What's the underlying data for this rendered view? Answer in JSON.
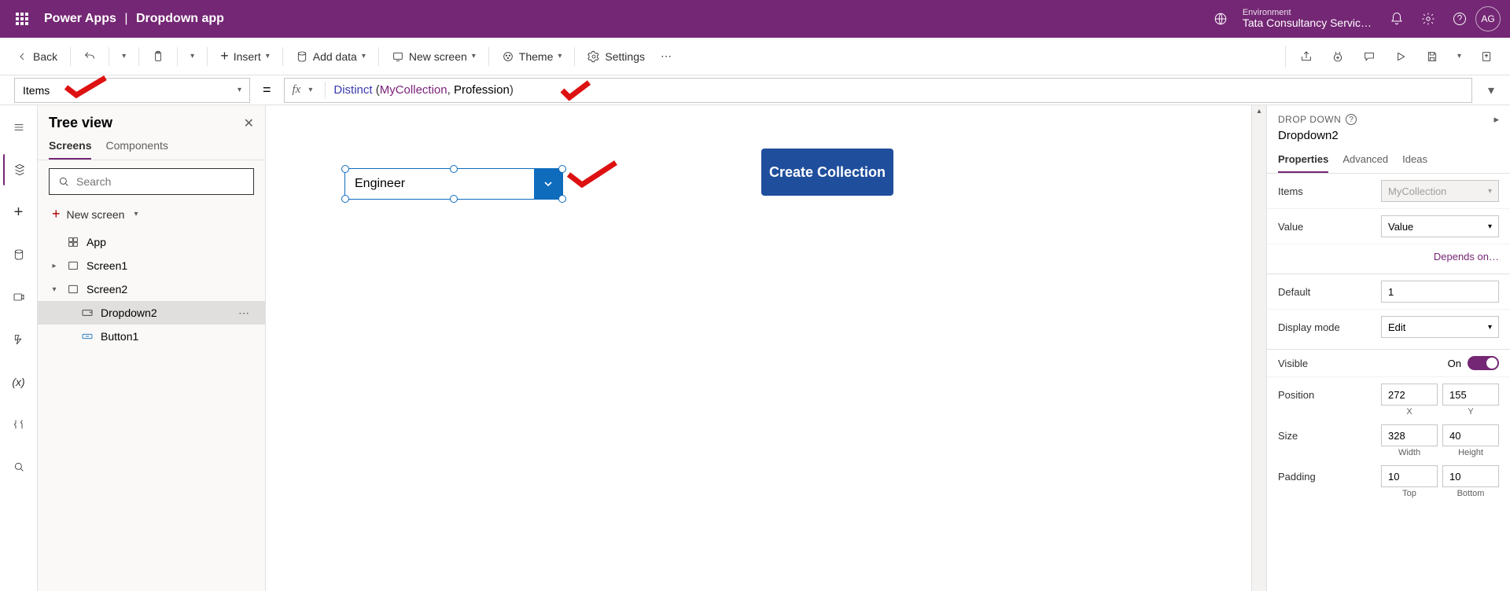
{
  "header": {
    "product": "Power Apps",
    "separator": "|",
    "app_name": "Dropdown app",
    "env_label": "Environment",
    "env_name": "Tata Consultancy Servic…",
    "avatar": "AG"
  },
  "cmdbar": {
    "back": "Back",
    "insert": "Insert",
    "add_data": "Add data",
    "new_screen": "New screen",
    "theme": "Theme",
    "settings": "Settings"
  },
  "formula": {
    "property": "Items",
    "fx_label": "fx",
    "func": "Distinct",
    "paren_open": "(",
    "collection": "MyCollection",
    "comma": ", ",
    "field": "Profession",
    "paren_close": ")"
  },
  "tree": {
    "title": "Tree view",
    "tabs": {
      "screens": "Screens",
      "components": "Components"
    },
    "search_placeholder": "Search",
    "new_screen": "New screen",
    "app": "App",
    "screen1": "Screen1",
    "screen2": "Screen2",
    "dropdown2": "Dropdown2",
    "button1": "Button1"
  },
  "canvas": {
    "dropdown_value": "Engineer",
    "create_button": "Create Collection"
  },
  "props": {
    "type_label": "DROP DOWN",
    "control_name": "Dropdown2",
    "tabs": {
      "properties": "Properties",
      "advanced": "Advanced",
      "ideas": "Ideas"
    },
    "items_label": "Items",
    "items_value": "MyCollection",
    "value_label": "Value",
    "value_value": "Value",
    "depends": "Depends on…",
    "default_label": "Default",
    "default_value": "1",
    "display_mode_label": "Display mode",
    "display_mode_value": "Edit",
    "visible_label": "Visible",
    "visible_on": "On",
    "position_label": "Position",
    "pos_x": "272",
    "pos_y": "155",
    "x_label": "X",
    "y_label": "Y",
    "size_label": "Size",
    "size_w": "328",
    "size_h": "40",
    "w_label": "Width",
    "h_label": "Height",
    "padding_label": "Padding",
    "pad_t": "10",
    "pad_b": "10",
    "t_label": "Top",
    "b_label": "Bottom"
  }
}
